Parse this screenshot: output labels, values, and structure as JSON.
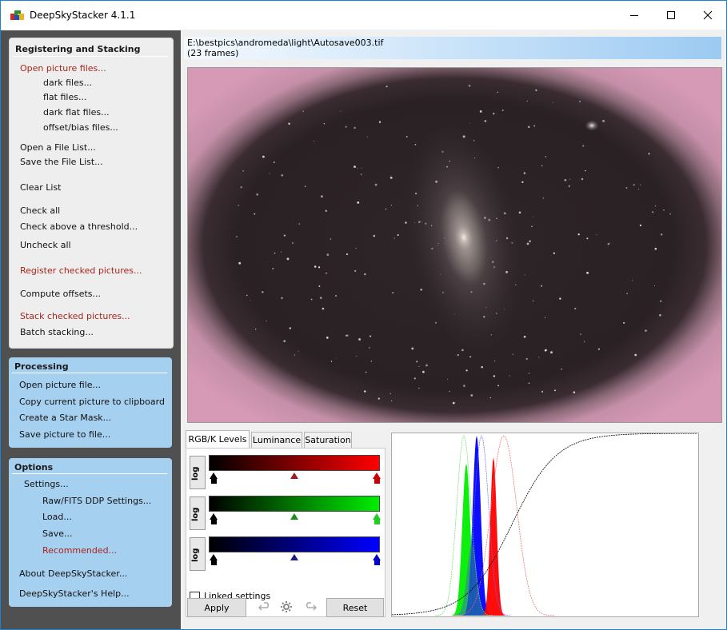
{
  "window": {
    "title": "DeepSkyStacker 4.1.1",
    "controls": {
      "minimize": "─",
      "maximize": "☐",
      "close": "✕"
    }
  },
  "sidebar": {
    "registering": {
      "header": "Registering and Stacking",
      "items": {
        "open_picture": "Open picture files...",
        "dark": "dark files...",
        "flat": "flat files...",
        "dark_flat": "dark flat files...",
        "offset": "offset/bias files...",
        "open_list": "Open a File List...",
        "save_list": "Save the File List...",
        "clear_list": "Clear List",
        "check_all": "Check all",
        "check_threshold": "Check above a threshold...",
        "uncheck_all": "Uncheck all",
        "register": "Register checked pictures...",
        "compute": "Compute offsets...",
        "stack": "Stack checked pictures...",
        "batch": "Batch stacking..."
      }
    },
    "processing": {
      "header": "Processing",
      "items": {
        "open_file": "Open picture file...",
        "copy_clipboard": "Copy current picture to clipboard",
        "star_mask": "Create a Star Mask...",
        "save_picture": "Save picture to file..."
      }
    },
    "options": {
      "header": "Options",
      "items": {
        "settings": "Settings...",
        "raw_fits": "Raw/FITS DDP Settings...",
        "load": "Load...",
        "save": "Save...",
        "recommended": "Recommended...",
        "about": "About DeepSkyStacker...",
        "help": "DeepSkyStacker's Help..."
      }
    }
  },
  "main": {
    "path": "E:\\bestpics\\andromeda\\light\\Autosave003.tif",
    "frames": "(23 frames)",
    "tabs": {
      "rgb": "RGB/K Levels",
      "luminance": "Luminance",
      "saturation": "Saturation"
    },
    "log_label": "log",
    "linked": "Linked settings",
    "apply": "Apply",
    "reset": "Reset"
  },
  "colors": {
    "red": "#ff0000",
    "green": "#00ee00",
    "blue": "#0000ff",
    "link_red": "#a8261c",
    "panel_blue": "#a6d0f0",
    "sidebar_bg": "#505050"
  }
}
